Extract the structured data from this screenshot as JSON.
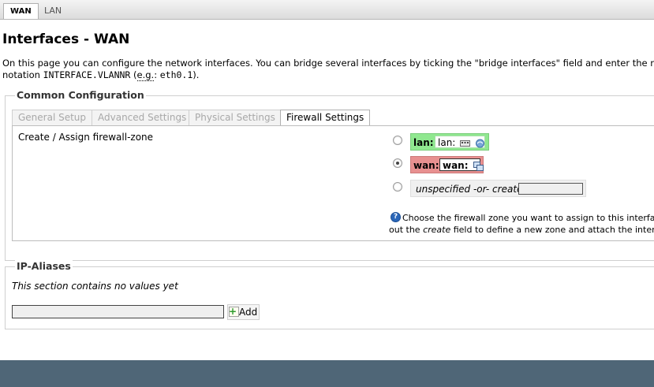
{
  "top_tabs": {
    "wan": "WAN",
    "lan": "LAN"
  },
  "page_title": "Interfaces - WAN",
  "description": {
    "line1": "On this page you can configure the network interfaces. You can bridge several interfaces by ticking the \"bridge interfaces\" field and enter the names of se",
    "line2_pre": "notation ",
    "line2_code1": "INTERFACE.VLANNR",
    "line2_mid": " (",
    "line2_eg": "e.g.",
    "line2_colon": ": ",
    "line2_code2": "eth0.1",
    "line2_end": ")."
  },
  "common_config": {
    "legend": "Common Configuration",
    "tabs": [
      "General Setup",
      "Advanced Settings",
      "Physical Settings",
      "Firewall Settings"
    ],
    "active_tab": "Firewall Settings",
    "field_label": "Create / Assign firewall-zone",
    "zones": {
      "lan": {
        "name": "lan:",
        "box": "lan:",
        "color": "#90e890",
        "selected": false
      },
      "wan": {
        "name": "wan:",
        "box": "wan:",
        "color": "#e89090",
        "selected": true
      },
      "unspecified": {
        "label": "unspecified -or- create:",
        "create_value": "",
        "selected": false
      }
    },
    "help": {
      "pre": "Choose the firewall zone you want to assign to this interface. Sele",
      "line2_pre": "out the ",
      "line2_em": "create",
      "line2_post": " field to define a new zone and attach the interface to it."
    }
  },
  "ip_aliases": {
    "legend": "IP-Aliases",
    "empty_text": "This section contains no values yet",
    "input_value": "",
    "add_label": "Add"
  },
  "colors": {
    "bottom_bar": "#4f6677",
    "lan_zone": "#90e890",
    "wan_zone": "#e89090",
    "help_icon": "#2a66b8"
  }
}
